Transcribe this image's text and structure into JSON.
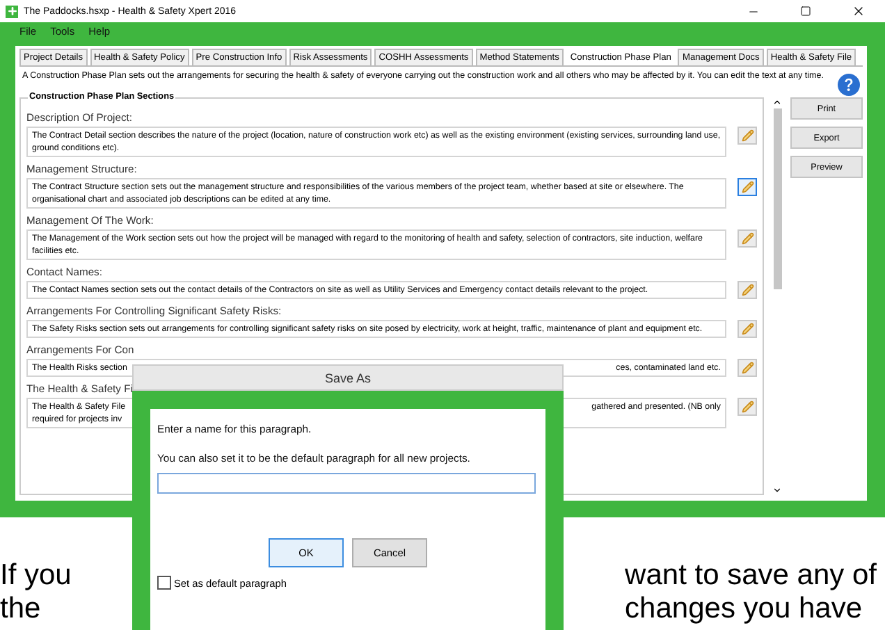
{
  "window": {
    "title": "The Paddocks.hsxp - Health & Safety Xpert 2016"
  },
  "menu": [
    "File",
    "Tools",
    "Help"
  ],
  "tabs": [
    {
      "label": "Project Details",
      "selected": false
    },
    {
      "label": "Health & Safety Policy",
      "selected": false
    },
    {
      "label": "Pre Construction Info",
      "selected": false
    },
    {
      "label": "Risk Assessments",
      "selected": false
    },
    {
      "label": "COSHH Assessments",
      "selected": false
    },
    {
      "label": "Method Statements",
      "selected": false
    },
    {
      "label": "Construction Phase Plan",
      "selected": true
    },
    {
      "label": "Management Docs",
      "selected": false
    },
    {
      "label": "Health & Safety File",
      "selected": false
    }
  ],
  "intro": "A Construction Phase Plan sets out the arrangements for securing the health & safety of everyone carrying out the construction work and all others who may be affected by it. You can edit the text at any time.",
  "group_title": "Construction Phase Plan Sections",
  "sections": [
    {
      "label": "Description Of Project:",
      "text": "The Contract Detail section describes the nature of the project (location, nature of construction work etc) as well as the existing environment (existing services, surrounding land use, ground conditions etc).",
      "edit_focused": false
    },
    {
      "label": "Management Structure:",
      "text": "The Contract Structure section sets out the management structure and responsibilities of the various members of the project team, whether based at site or elsewhere. The organisational chart and associated job descriptions can be edited at any time.",
      "edit_focused": true
    },
    {
      "label": "Management Of The Work:",
      "text": "The Management of the Work section sets out how the project will be managed with regard to the monitoring of health and safety, selection of contractors, site induction, welfare facilities etc.",
      "edit_focused": false
    },
    {
      "label": "Contact Names:",
      "text": "The Contact Names section sets out the contact details of the Contractors on site as well as Utility Services and Emergency contact details relevant to the project.",
      "edit_focused": false
    },
    {
      "label": "Arrangements For Controlling Significant Safety Risks:",
      "text": "The Safety Risks section sets out arrangements for controlling significant safety risks on site posed by electricity, work at height, traffic, maintenance of plant and equipment etc.",
      "edit_focused": false
    },
    {
      "label": "Arrangements For Con",
      "text_left": "The Health Risks section",
      "text_right": "ces, contaminated land etc.",
      "edit_focused": false
    },
    {
      "label": "The Health & Safety Fi",
      "text_left": "The Health & Safety File\nrequired for projects inv",
      "text_right": "gathered and presented. (NB only",
      "edit_focused": false
    }
  ],
  "buttons": [
    "Print",
    "Export",
    "Preview"
  ],
  "dialog": {
    "title": "Save As",
    "line_1": "Enter a name for this paragraph.",
    "line_2": "You can also set it to be the default paragraph for all new projects.",
    "ok": "OK",
    "cancel": "Cancel",
    "ok_focused": true,
    "checkbox": {
      "label": "Set as default paragraph",
      "checked": false
    }
  },
  "page_text": {
    "left_1": "If you",
    "right_1": "want to save any of",
    "left_2": "the",
    "right_2": "changes you have"
  }
}
